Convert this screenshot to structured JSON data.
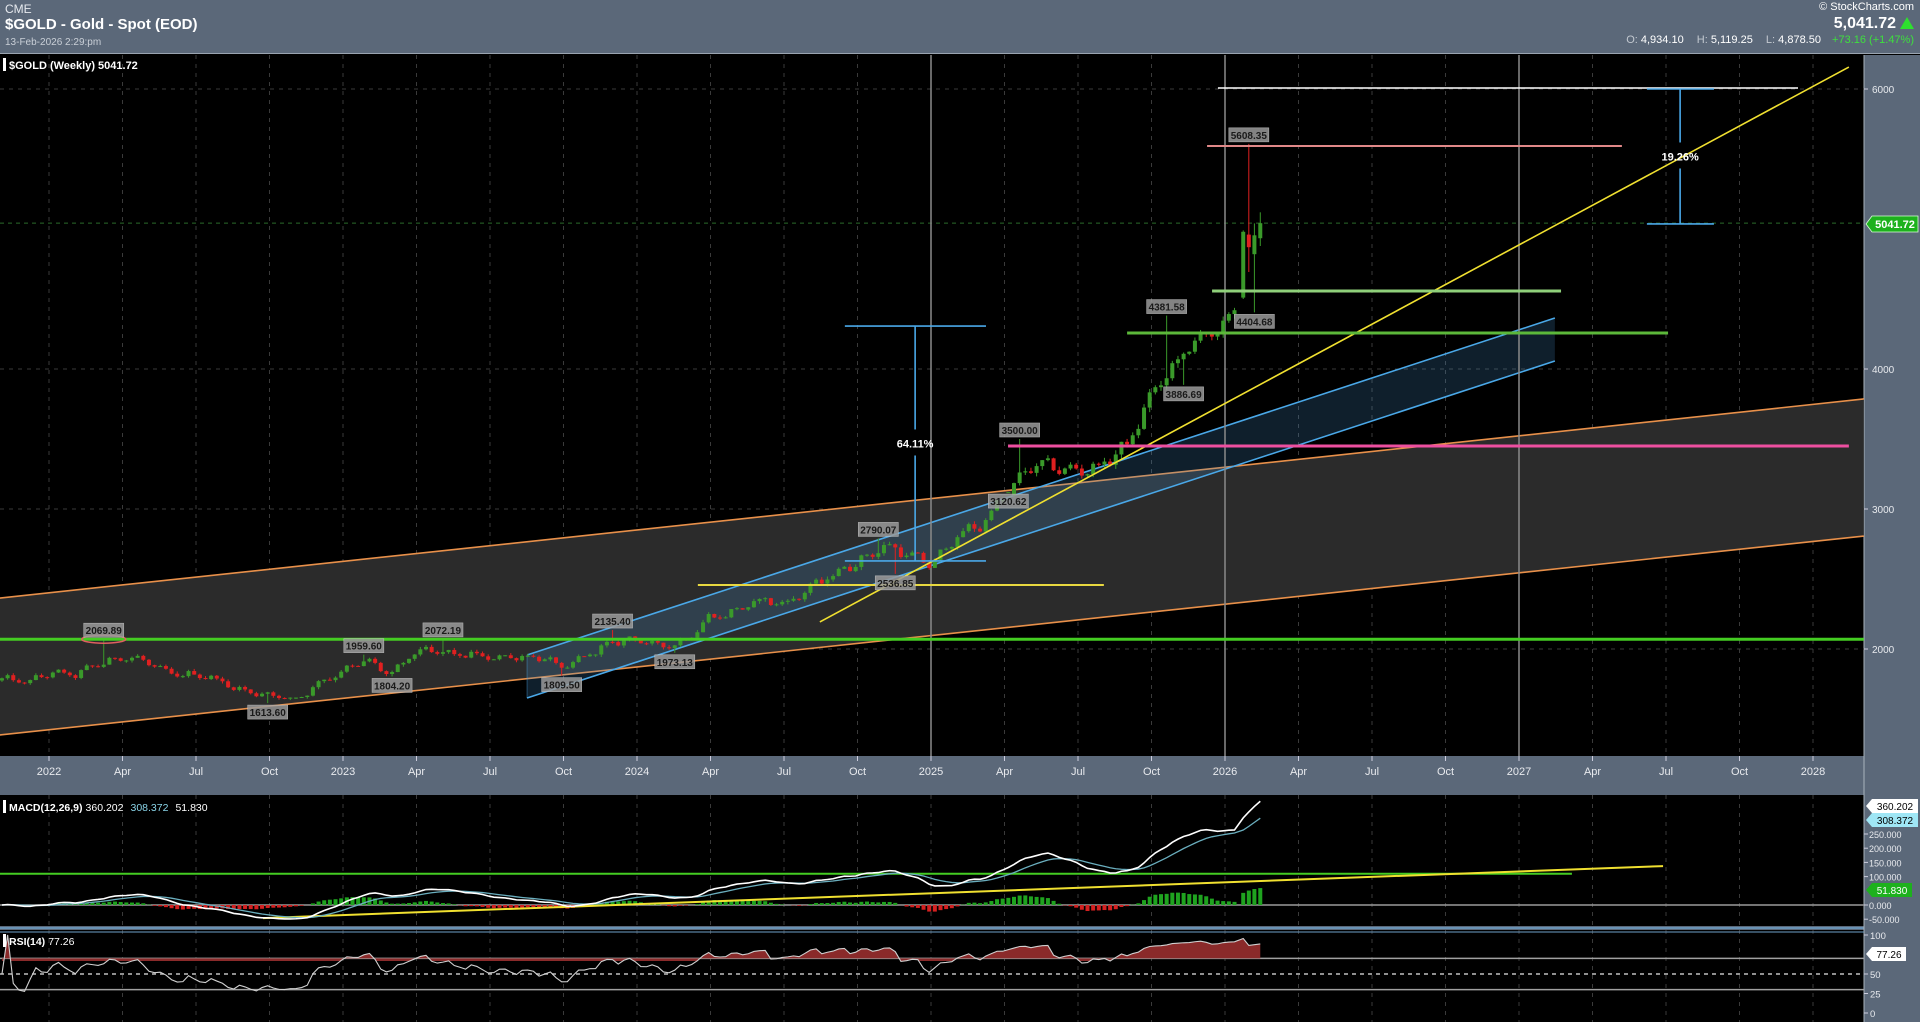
{
  "header": {
    "exchange": "CME",
    "title": "$GOLD - Gold - Spot (EOD)",
    "datetime": "13-Feb-2026 2:29:pm",
    "copyright": "© StockCharts.com",
    "last": "5,041.72",
    "open_label": "O:",
    "open": "4,934.10",
    "high_label": "H:",
    "high": "5,119.25",
    "low_label": "L:",
    "low": "4,878.50",
    "change": "+73.16 (+1.47%)"
  },
  "colors": {
    "up": "#3a9a2a",
    "down": "#e02020",
    "orange": "#e8904a",
    "blue": "#4aa8e8",
    "yellow": "#f0e030",
    "green": "#44cc22",
    "pink": "#ee4fa0",
    "axis_bg": "#5b6879"
  },
  "chart_data": {
    "type": "candlestick",
    "title": "$GOLD (Weekly) 5041.72",
    "last_price_label": "5041.72",
    "y_ticks": [
      "2000",
      "3000",
      "4000",
      "6000"
    ],
    "y_tick_values": [
      2000,
      3000,
      4000,
      6000
    ],
    "ylim": [
      1000,
      6500
    ],
    "x_ticks": [
      {
        "label": "2022",
        "t": 2022
      },
      {
        "label": "Apr",
        "t": 2022.25
      },
      {
        "label": "Jul",
        "t": 2022.5
      },
      {
        "label": "Oct",
        "t": 2022.75
      },
      {
        "label": "2023",
        "t": 2023
      },
      {
        "label": "Apr",
        "t": 2023.25
      },
      {
        "label": "Jul",
        "t": 2023.5
      },
      {
        "label": "Oct",
        "t": 2023.75
      },
      {
        "label": "2024",
        "t": 2024
      },
      {
        "label": "Apr",
        "t": 2024.25
      },
      {
        "label": "Jul",
        "t": 2024.5
      },
      {
        "label": "Oct",
        "t": 2024.75
      },
      {
        "label": "2025",
        "t": 2025
      },
      {
        "label": "Apr",
        "t": 2025.25
      },
      {
        "label": "Jul",
        "t": 2025.5
      },
      {
        "label": "Oct",
        "t": 2025.75
      },
      {
        "label": "2026",
        "t": 2026
      },
      {
        "label": "Apr",
        "t": 2026.25
      },
      {
        "label": "Jul",
        "t": 2026.5
      },
      {
        "label": "Oct",
        "t": 2026.75
      },
      {
        "label": "2027",
        "t": 2027
      },
      {
        "label": "Apr",
        "t": 2027.25
      },
      {
        "label": "Jul",
        "t": 2027.5
      },
      {
        "label": "Oct",
        "t": 2027.75
      },
      {
        "label": "2028",
        "t": 2028
      }
    ],
    "close_path": [
      [
        "2021-11",
        1775
      ],
      [
        "2021-12",
        1829
      ],
      [
        "2022-01",
        1797
      ],
      [
        "2022-02",
        1909
      ],
      [
        "2022-03",
        1937
      ],
      [
        "2022-04",
        1897
      ],
      [
        "2022-05",
        1837
      ],
      [
        "2022-06",
        1807
      ],
      [
        "2022-07",
        1766
      ],
      [
        "2022-08",
        1711
      ],
      [
        "2022-09",
        1661
      ],
      [
        "2022-10",
        1633
      ],
      [
        "2022-11",
        1768
      ],
      [
        "2022-12",
        1824
      ],
      [
        "2023-01",
        1928
      ],
      [
        "2023-02",
        1827
      ],
      [
        "2023-03",
        1969
      ],
      [
        "2023-04",
        1990
      ],
      [
        "2023-05",
        1963
      ],
      [
        "2023-06",
        1919
      ],
      [
        "2023-07",
        1965
      ],
      [
        "2023-08",
        1940
      ],
      [
        "2023-09",
        1849
      ],
      [
        "2023-10",
        1983
      ],
      [
        "2023-11",
        2036
      ],
      [
        "2023-12",
        2063
      ],
      [
        "2024-01",
        2039
      ],
      [
        "2024-02",
        2044
      ],
      [
        "2024-03",
        2230
      ],
      [
        "2024-04",
        2286
      ],
      [
        "2024-05",
        2327
      ],
      [
        "2024-06",
        2326
      ],
      [
        "2024-07",
        2447
      ],
      [
        "2024-08",
        2503
      ],
      [
        "2024-09",
        2634
      ],
      [
        "2024-10",
        2743
      ],
      [
        "2024-11",
        2657
      ],
      [
        "2024-12",
        2625
      ],
      [
        "2025-01",
        2798
      ],
      [
        "2025-02",
        2858
      ],
      [
        "2025-03",
        3124
      ],
      [
        "2025-04",
        3288
      ],
      [
        "2025-05",
        3289
      ],
      [
        "2025-06",
        3303
      ],
      [
        "2025-07",
        3290
      ],
      [
        "2025-08",
        3448
      ],
      [
        "2025-09",
        3858
      ],
      [
        "2025-10",
        4002
      ],
      [
        "2025-11",
        4239
      ],
      [
        "2025-12",
        4330
      ],
      [
        "2026-01",
        4600
      ]
    ],
    "recent_candles": [
      {
        "t": 2026.062,
        "o": 4510,
        "h": 4990,
        "l": 4500,
        "c": 4980
      },
      {
        "t": 2026.081,
        "o": 4960,
        "h": 5608.35,
        "l": 4693,
        "c": 4870
      },
      {
        "t": 2026.1,
        "o": 4820,
        "h": 5040,
        "l": 4404.68,
        "c": 4955
      },
      {
        "t": 2026.12,
        "o": 4934.1,
        "h": 5119.25,
        "l": 4878.5,
        "c": 5041.72
      }
    ],
    "price_labels": [
      {
        "text": "2069.89",
        "t": 2022.19,
        "kind": "high",
        "circled": true
      },
      {
        "text": "1613.60",
        "t": 2022.74,
        "kind": "low"
      },
      {
        "text": "1959.60",
        "t": 2023.08,
        "kind": "high"
      },
      {
        "text": "1804.20",
        "t": 2023.16,
        "kind": "low"
      },
      {
        "text": "2072.19",
        "t": 2023.34,
        "kind": "high"
      },
      {
        "text": "1809.50",
        "t": 2023.75,
        "kind": "low"
      },
      {
        "text": "2135.40",
        "t": 2023.92,
        "kind": "high"
      },
      {
        "text": "1973.13",
        "t": 2024.12,
        "kind": "low"
      },
      {
        "text": "2790.07",
        "t": 2024.83,
        "kind": "high"
      },
      {
        "text": "2536.85",
        "t": 2024.88,
        "kind": "low"
      },
      {
        "text": "3120.62",
        "t": 2025.27,
        "kind": "low"
      },
      {
        "text": "3500.00",
        "t": 2025.31,
        "kind": "high"
      },
      {
        "text": "4381.58",
        "t": 2025.8,
        "kind": "high"
      },
      {
        "text": "3886.69",
        "t": 2025.86,
        "kind": "low"
      },
      {
        "text": "4404.68",
        "t": 2026.1,
        "kind": "low"
      },
      {
        "text": "5608.35",
        "t": 2026.081,
        "kind": "high"
      }
    ],
    "channels": [
      {
        "name": "long-term-channel",
        "color": "#e8904a",
        "fill": "#2b2b2b",
        "upper": [
          [
            2021.833,
            2364
          ],
          [
            2028.173,
            3786
          ]
        ],
        "lower": [
          [
            2021.833,
            1386
          ],
          [
            2028.173,
            2807
          ]
        ]
      },
      {
        "name": "rising-channel",
        "color": "#4aa8e8",
        "fill": "rgba(70,140,200,0.22)",
        "upper": [
          [
            2023.626,
            1957
          ],
          [
            2027.122,
            4364
          ]
        ],
        "lower": [
          [
            2023.626,
            1650
          ],
          [
            2027.122,
            4057
          ]
        ]
      }
    ],
    "trendlines": [
      {
        "name": "yellow-trendline",
        "color": "#f0e030",
        "width": 1.6,
        "from": [
          2024.622,
          2193
        ],
        "to": [
          2028.122,
          6157
        ]
      },
      {
        "name": "support-2069",
        "color": "#44cc22",
        "width": 3,
        "from": [
          2021.833,
          2069.89
        ],
        "to": [
          2028.173,
          2069.89
        ]
      },
      {
        "name": "resistance-3500",
        "color": "#ee4fa0",
        "width": 3,
        "from": [
          2025.262,
          3450
        ],
        "to": [
          2028.122,
          3450
        ]
      },
      {
        "name": "level-4557",
        "color": "#8fd07a",
        "width": 3,
        "from": [
          2025.956,
          4557
        ],
        "to": [
          2027.143,
          4557
        ]
      },
      {
        "name": "level-4257",
        "color": "#5cb83a",
        "width": 3,
        "from": [
          2025.667,
          4257
        ],
        "to": [
          2027.507,
          4257
        ]
      },
      {
        "name": "level-5608",
        "color": "#e08888",
        "width": 2,
        "from": [
          2025.939,
          5593
        ],
        "to": [
          2027.35,
          5593
        ]
      },
      {
        "name": "level-6000",
        "color": "#ffffff",
        "width": 1.5,
        "from": [
          2025.976,
          6007
        ],
        "to": [
          2027.949,
          6007
        ]
      },
      {
        "name": "level-2457",
        "color": "#e8d840",
        "width": 2,
        "from": [
          2024.207,
          2457
        ],
        "to": [
          2025.588,
          2457
        ]
      }
    ],
    "measures": [
      {
        "label": "64.11%",
        "t": 2024.946,
        "t0": 2024.707,
        "t1": 2025.187,
        "top": 4307,
        "bottom": 2629
      },
      {
        "label": "19.26%",
        "t": 2027.548,
        "t0": 2027.435,
        "t1": 2027.663,
        "top": 6000,
        "bottom": 5036
      }
    ],
    "year_markers": [
      2025,
      2026,
      2027
    ]
  },
  "macd": {
    "label": "MACD(12,26,9)",
    "macd_value": "360.202",
    "signal_value": "308.372",
    "hist_value": "51.830",
    "ticks": [
      "250.000",
      "200.000",
      "150.000",
      "100.000",
      "0.000",
      "-50.000"
    ],
    "tick_values": [
      250,
      200,
      150,
      100,
      0,
      -50
    ],
    "green_level": {
      "value": 110,
      "from": 2021.833,
      "to": 2027.18
    },
    "yellow_trend": {
      "from": [
        2022.728,
        -46
      ],
      "to": [
        2027.49,
        137
      ]
    }
  },
  "rsi": {
    "label": "RSI(14)",
    "value": "77.26",
    "ticks": [
      "100",
      "50",
      "25",
      "0"
    ],
    "tick_values": [
      100,
      50,
      25,
      0
    ]
  }
}
